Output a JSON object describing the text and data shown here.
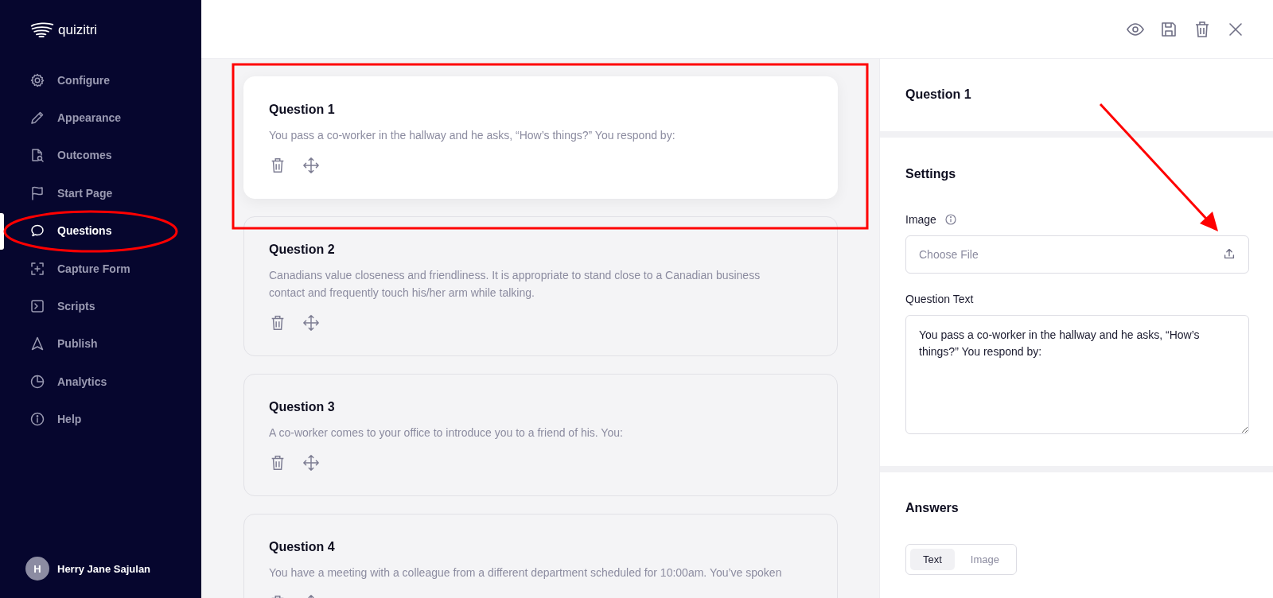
{
  "logo": {
    "name": "quizitri"
  },
  "sidebar": {
    "items": [
      {
        "label": "Configure",
        "selected": false
      },
      {
        "label": "Appearance",
        "selected": false
      },
      {
        "label": "Outcomes",
        "selected": false
      },
      {
        "label": "Start Page",
        "selected": false
      },
      {
        "label": "Questions",
        "selected": true
      },
      {
        "label": "Capture Form",
        "selected": false
      },
      {
        "label": "Scripts",
        "selected": false
      },
      {
        "label": "Publish",
        "selected": false
      },
      {
        "label": "Analytics",
        "selected": false
      },
      {
        "label": "Help",
        "selected": false
      }
    ],
    "user": {
      "initial": "H",
      "name": "Herry Jane Sajulan"
    }
  },
  "questions": [
    {
      "title": "Question 1",
      "text": "You pass a co-worker in the hallway and he asks, “How’s things?” You respond by:",
      "selected": true
    },
    {
      "title": "Question 2",
      "text": "Canadians value closeness and friendliness. It is appropriate to stand close to a Canadian business contact and frequently touch his/her arm while talking.",
      "selected": false
    },
    {
      "title": "Question 3",
      "text": "A co-worker comes to your office to introduce you to a friend of his. You:",
      "selected": false
    },
    {
      "title": "Question 4",
      "text": "You have a meeting with a colleague from a different department scheduled for 10:00am. You’ve spoken",
      "selected": false
    }
  ],
  "panel": {
    "title": "Question 1",
    "settings": {
      "heading": "Settings",
      "image_label": "Image",
      "file_placeholder": "Choose File",
      "text_label": "Question Text",
      "text_value": "You pass a co-worker in the hallway and he asks, “How’s things?” You respond by:"
    },
    "answers": {
      "heading": "Answers",
      "tabs": [
        {
          "label": "Text",
          "selected": true
        },
        {
          "label": "Image",
          "selected": false
        }
      ]
    }
  }
}
